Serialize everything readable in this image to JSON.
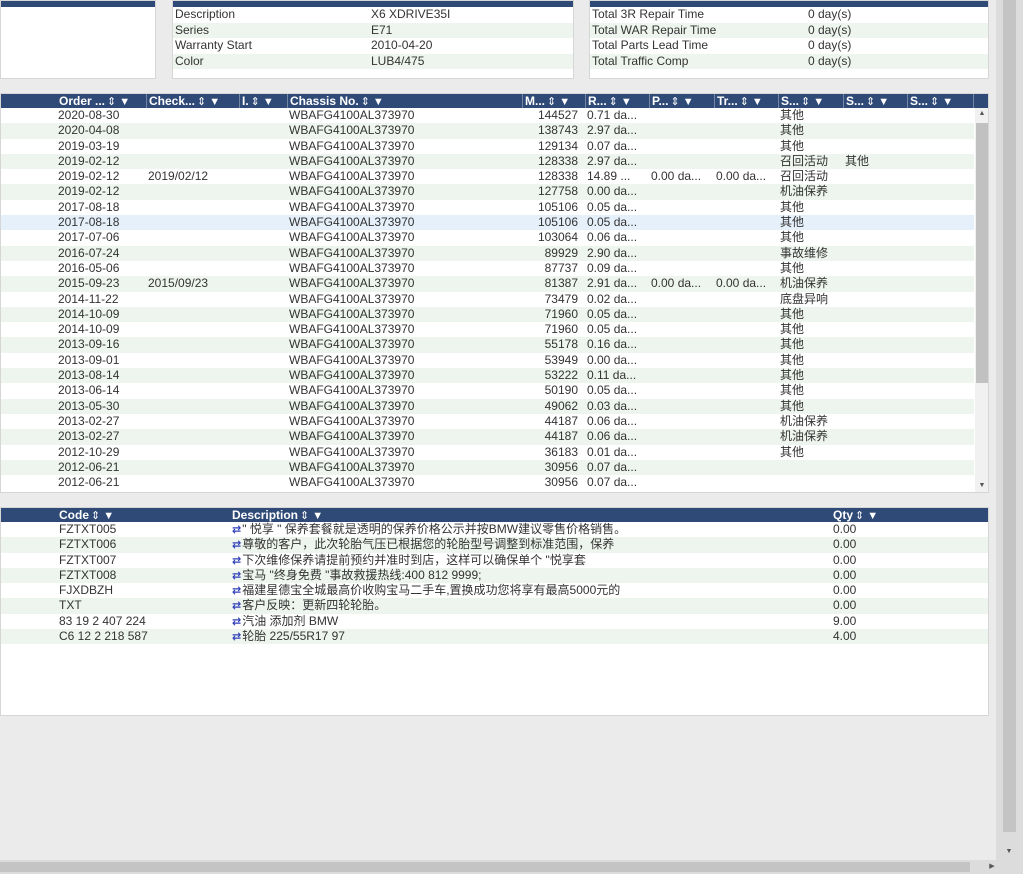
{
  "vehicle_info": {
    "rows": [
      {
        "label": "Description",
        "value": "X6 XDRIVE35I"
      },
      {
        "label": "Series",
        "value": "E71"
      },
      {
        "label": "Warranty Start",
        "value": "2010-04-20"
      },
      {
        "label": "Color",
        "value": "LUB4/475"
      }
    ]
  },
  "time_info": {
    "rows": [
      {
        "label": "Total 3R Repair Time",
        "value": "0 day(s)"
      },
      {
        "label": "Total WAR Repair Time",
        "value": "0 day(s)"
      },
      {
        "label": "Total Parts Lead Time",
        "value": "0 day(s)"
      },
      {
        "label": "Total Traffic Comp",
        "value": "0 day(s)"
      }
    ]
  },
  "orders": {
    "headers": [
      "Order ...",
      "Check...",
      "I.",
      "Chassis No.",
      "M...",
      "R...",
      "P...",
      "Tr...",
      "S...",
      "S...",
      "S..."
    ],
    "sort_icon": "⇕",
    "filter_icon": "▼",
    "rows": [
      [
        "2020-08-30",
        "",
        "",
        "WBAFG4100AL373970",
        "144527",
        "0.71 da...",
        "",
        "",
        "其他",
        "",
        ""
      ],
      [
        "2020-04-08",
        "",
        "",
        "WBAFG4100AL373970",
        "138743",
        "2.97 da...",
        "",
        "",
        "其他",
        "",
        ""
      ],
      [
        "2019-03-19",
        "",
        "",
        "WBAFG4100AL373970",
        "129134",
        "0.07 da...",
        "",
        "",
        "其他",
        "",
        ""
      ],
      [
        "2019-02-12",
        "",
        "",
        "WBAFG4100AL373970",
        "128338",
        "2.97 da...",
        "",
        "",
        "召回活动",
        "其他",
        ""
      ],
      [
        "2019-02-12",
        "2019/02/12",
        "",
        "WBAFG4100AL373970",
        "128338",
        "14.89 ...",
        "0.00 da...",
        "0.00 da...",
        "召回活动",
        "",
        ""
      ],
      [
        "2019-02-12",
        "",
        "",
        "WBAFG4100AL373970",
        "127758",
        "0.00 da...",
        "",
        "",
        "机油保养",
        "",
        ""
      ],
      [
        "2017-08-18",
        "",
        "",
        "WBAFG4100AL373970",
        "105106",
        "0.05 da...",
        "",
        "",
        "其他",
        "",
        ""
      ],
      [
        "2017-08-18",
        "",
        "",
        "WBAFG4100AL373970",
        "105106",
        "0.05 da...",
        "",
        "",
        "其他",
        "",
        ""
      ],
      [
        "2017-07-06",
        "",
        "",
        "WBAFG4100AL373970",
        "103064",
        "0.06 da...",
        "",
        "",
        "其他",
        "",
        ""
      ],
      [
        "2016-07-24",
        "",
        "",
        "WBAFG4100AL373970",
        "89929",
        "2.90 da...",
        "",
        "",
        "事故维修",
        "",
        ""
      ],
      [
        "2016-05-06",
        "",
        "",
        "WBAFG4100AL373970",
        "87737",
        "0.09 da...",
        "",
        "",
        "其他",
        "",
        ""
      ],
      [
        "2015-09-23",
        "2015/09/23",
        "",
        "WBAFG4100AL373970",
        "81387",
        "2.91 da...",
        "0.00 da...",
        "0.00 da...",
        "机油保养",
        "",
        ""
      ],
      [
        "2014-11-22",
        "",
        "",
        "WBAFG4100AL373970",
        "73479",
        "0.02 da...",
        "",
        "",
        "底盘异响",
        "",
        ""
      ],
      [
        "2014-10-09",
        "",
        "",
        "WBAFG4100AL373970",
        "71960",
        "0.05 da...",
        "",
        "",
        "其他",
        "",
        ""
      ],
      [
        "2014-10-09",
        "",
        "",
        "WBAFG4100AL373970",
        "71960",
        "0.05 da...",
        "",
        "",
        "其他",
        "",
        ""
      ],
      [
        "2013-09-16",
        "",
        "",
        "WBAFG4100AL373970",
        "55178",
        "0.16 da...",
        "",
        "",
        "其他",
        "",
        ""
      ],
      [
        "2013-09-01",
        "",
        "",
        "WBAFG4100AL373970",
        "53949",
        "0.00 da...",
        "",
        "",
        "其他",
        "",
        ""
      ],
      [
        "2013-08-14",
        "",
        "",
        "WBAFG4100AL373970",
        "53222",
        "0.11 da...",
        "",
        "",
        "其他",
        "",
        ""
      ],
      [
        "2013-06-14",
        "",
        "",
        "WBAFG4100AL373970",
        "50190",
        "0.05 da...",
        "",
        "",
        "其他",
        "",
        ""
      ],
      [
        "2013-05-30",
        "",
        "",
        "WBAFG4100AL373970",
        "49062",
        "0.03 da...",
        "",
        "",
        "其他",
        "",
        ""
      ],
      [
        "2013-02-27",
        "",
        "",
        "WBAFG4100AL373970",
        "44187",
        "0.06 da...",
        "",
        "",
        "机油保养",
        "",
        ""
      ],
      [
        "2013-02-27",
        "",
        "",
        "WBAFG4100AL373970",
        "44187",
        "0.06 da...",
        "",
        "",
        "机油保养",
        "",
        ""
      ],
      [
        "2012-10-29",
        "",
        "",
        "WBAFG4100AL373970",
        "36183",
        "0.01 da...",
        "",
        "",
        "其他",
        "",
        ""
      ],
      [
        "2012-06-21",
        "",
        "",
        "WBAFG4100AL373970",
        "30956",
        "0.07 da...",
        "",
        "",
        "",
        "",
        ""
      ],
      [
        "2012-06-21",
        "",
        "",
        "WBAFG4100AL373970",
        "30956",
        "0.07 da...",
        "",
        "",
        "",
        "",
        ""
      ]
    ],
    "highlighted_row": 7
  },
  "items": {
    "headers": [
      "Code",
      "Description",
      "Qty"
    ],
    "transfer_icon": "⇄",
    "rows": [
      [
        "FZTXT005",
        "\" 悦享 \" 保养套餐就是透明的保养价格公示并按BMW建议零售价格销售。",
        "0.00"
      ],
      [
        "FZTXT006",
        "尊敬的客户，此次轮胎气压已根据您的轮胎型号调整到标准范围，保养",
        "0.00"
      ],
      [
        "FZTXT007",
        "下次维修保养请提前预约并准时到店，这样可以确保单个 \"悦享套",
        "0.00"
      ],
      [
        "FZTXT008",
        "宝马 \"终身免费 \"事故救援热线:400 812 9999;",
        "0.00"
      ],
      [
        "FJXDBZH",
        "福建星德宝全城最高价收购宝马二手车,置换成功您将享有最高5000元的",
        "0.00"
      ],
      [
        "TXT",
        "客户反映：更新四轮轮胎。",
        "0.00"
      ],
      [
        "83 19 2 407 224",
        "汽油 添加剂 BMW",
        "9.00"
      ],
      [
        "C6 12 2 218 587",
        "轮胎 225/55R17 97",
        "4.00"
      ]
    ]
  }
}
